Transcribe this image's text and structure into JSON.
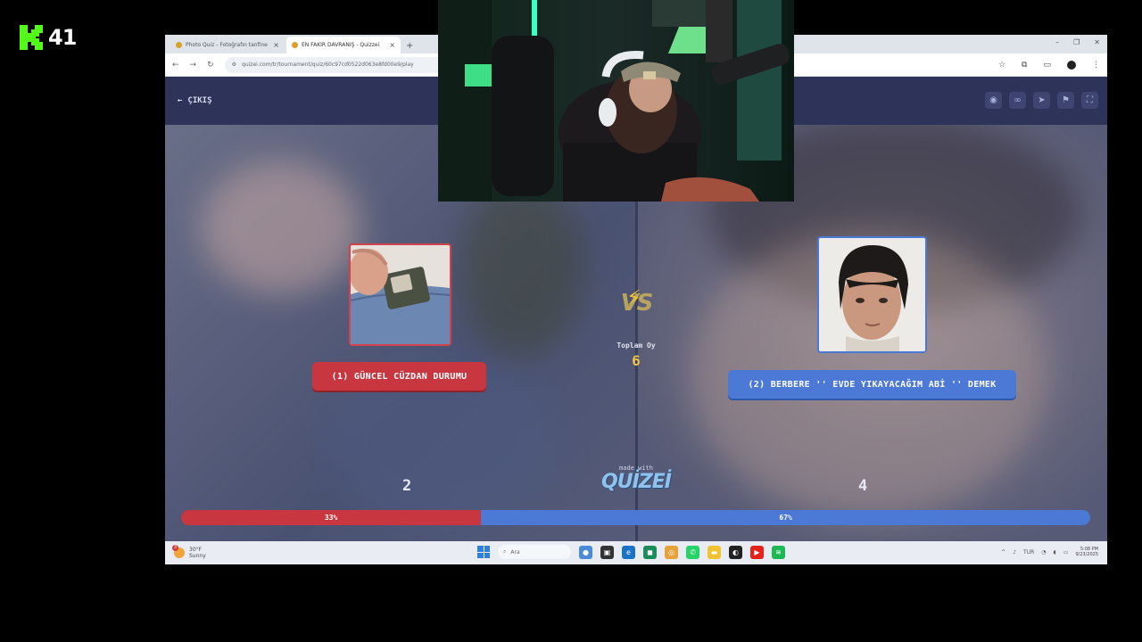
{
  "stream": {
    "logo_letter": "K",
    "viewer_count": "41",
    "accent_color": "#53fc18"
  },
  "browser": {
    "tabs": [
      {
        "title": "Photo Quiz - Fotoğrafın tanfine",
        "active": false
      },
      {
        "title": "EN FAKİR DAVRANIŞ - Quizzei",
        "active": true
      }
    ],
    "url": "quizei.com/tr/tournament/quiz/60c97cd0522d063e8fd00e9/play"
  },
  "app": {
    "exit_label": "ÇIKIŞ",
    "header_icons": [
      "eye-icon",
      "link-icon",
      "send-icon",
      "flag-icon",
      "fullscreen-icon"
    ],
    "left_option": {
      "label": "(1) GÜNCEL CÜZDAN DURUMU",
      "votes": "2",
      "percent_label": "33%",
      "percent": 33,
      "color": "#c8373f"
    },
    "right_option": {
      "label": "(2) BERBERE '' EVDE YIKAYACAĞIM ABİ '' DEMEK",
      "votes": "4",
      "percent_label": "67%",
      "percent": 67,
      "color": "#4c79d6"
    },
    "vs_text": "VS",
    "total_label": "Toplam Oy",
    "total_value": "6",
    "made_with": "made with",
    "brand": "QUİZEİ"
  },
  "taskbar": {
    "weather_temp": "30°F",
    "weather_desc": "Sunny",
    "weather_badge": "3",
    "search_placeholder": "Ara",
    "lang": "TUR",
    "time": "5:08 PM",
    "date": "9/23/2025"
  }
}
